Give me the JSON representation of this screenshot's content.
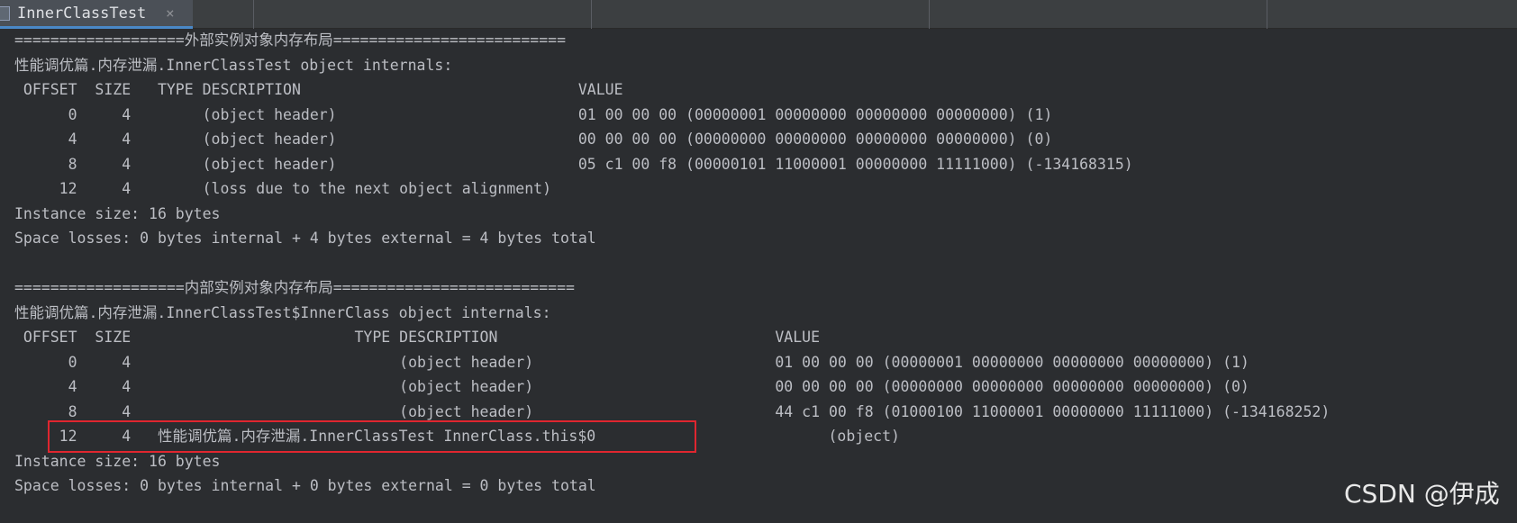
{
  "tab": {
    "label": "InnerClassTest",
    "close_glyph": "×"
  },
  "console": {
    "lines": [
      "===================外部实例对象内存布局==========================",
      "性能调优篇.内存泄漏.InnerClassTest object internals:",
      " OFFSET  SIZE   TYPE DESCRIPTION                               VALUE",
      "      0     4        (object header)                           01 00 00 00 (00000001 00000000 00000000 00000000) (1)",
      "      4     4        (object header)                           00 00 00 00 (00000000 00000000 00000000 00000000) (0)",
      "      8     4        (object header)                           05 c1 00 f8 (00000101 11000001 00000000 11111000) (-134168315)",
      "     12     4        (loss due to the next object alignment)",
      "Instance size: 16 bytes",
      "Space losses: 0 bytes internal + 4 bytes external = 4 bytes total",
      "",
      "===================内部实例对象内存布局===========================",
      "性能调优篇.内存泄漏.InnerClassTest$InnerClass object internals:",
      " OFFSET  SIZE                         TYPE DESCRIPTION                               VALUE",
      "      0     4                              (object header)                           01 00 00 00 (00000001 00000000 00000000 00000000) (1)",
      "      4     4                              (object header)                           00 00 00 00 (00000000 00000000 00000000 00000000) (0)",
      "      8     4                              (object header)                           44 c1 00 f8 (01000100 11000001 00000000 11111000) (-134168252)",
      "     12     4   性能调优篇.内存泄漏.InnerClassTest InnerClass.this$0                          (object)",
      "Instance size: 16 bytes",
      "Space losses: 0 bytes internal + 0 bytes external = 0 bytes total"
    ]
  },
  "watermark": "CSDN @伊成"
}
